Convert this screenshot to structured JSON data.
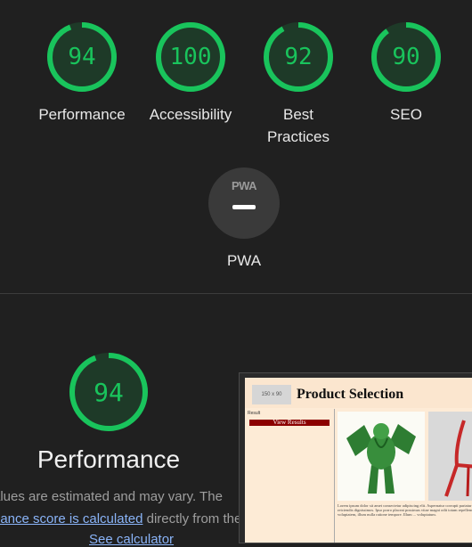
{
  "scores": [
    {
      "label": "Performance",
      "value": "94",
      "score": 94
    },
    {
      "label": "Accessibility",
      "value": "100",
      "score": 100
    },
    {
      "label": "Best Practices",
      "value": "92",
      "score": 92
    },
    {
      "label": "SEO",
      "value": "90",
      "score": 90
    }
  ],
  "pwa": {
    "badge": "PWA",
    "label": "PWA"
  },
  "performance": {
    "score": "94",
    "score_value": 94,
    "title": "Performance",
    "desc_line1": "alues are estimated and may vary. The",
    "desc_link": "nance score is calculated",
    "desc_line2_rest": " directly from these",
    "desc_line3_link": "See calculator"
  },
  "thumbnail": {
    "logo": "150 x 90",
    "title": "Product Selection",
    "side_text": "Result",
    "button": "View Results",
    "body_text": "Lorem ipsum dolor sit amet consectetur adipiscing elit. Aspernatur corrupti pariatur reiciendis dignissimos. Ipso porro placeat possimus vitae magni odit totam repellendus voluptatem, illum nulla ratione tempore. Illum ... voluptatum."
  },
  "colors": {
    "accent": "#19c45c",
    "background": "#202020",
    "track": "#1e3a28",
    "pwa_circle": "#3a3a3a"
  }
}
